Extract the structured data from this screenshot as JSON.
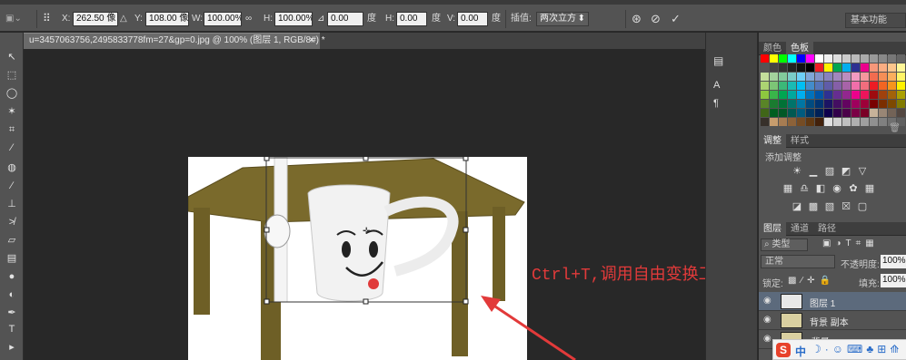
{
  "options_bar": {
    "x_label": "X:",
    "x_value": "262.50 像",
    "y_label": "Y:",
    "y_value": "108.00 像",
    "w_label": "W:",
    "w_value": "100.00%",
    "h_label": "H:",
    "h_value": "100.00%",
    "rotate_value": "0.00",
    "rotate_unit": "度",
    "hskew_label": "H:",
    "hskew_value": "0.00",
    "hskew_unit": "度",
    "vskew_label": "V:",
    "vskew_value": "0.00",
    "vskew_unit": "度",
    "interp_label": "插值:",
    "interp_value": "两次立方",
    "essentials": "基本功能"
  },
  "document": {
    "tab_title": "u=3457063756,2495833778fm=27&gp=0.jpg @ 100% (图层 1, RGB/8#) *",
    "tab_close": "×"
  },
  "annotation": {
    "text": "Ctrl+T,调用自由变换工具",
    "color": "#e23a3a"
  },
  "panels": {
    "swatch_tabs": [
      "颜色",
      "色板"
    ],
    "adjust_tabs": [
      "调整",
      "样式"
    ],
    "adjust_title": "添加调整",
    "layer_tabs": [
      "图层",
      "通道",
      "路径"
    ],
    "filter_kind": "类型",
    "blend_mode": "正常",
    "opacity_label": "不透明度:",
    "opacity_value": "100%",
    "lock_label": "锁定:",
    "fill_label": "填充:",
    "fill_value": "100%",
    "layers": [
      {
        "name": "图层 1",
        "selected": true
      },
      {
        "name": "背景 副本",
        "selected": false
      },
      {
        "name": "背景",
        "selected": false
      }
    ]
  },
  "ime": {
    "text": "中"
  },
  "colors": {
    "accent_selected_layer": "#5c6a7c",
    "panel_bg": "#535353",
    "canvas_bg": "#282828",
    "table_olive": "#7a6a2c"
  }
}
